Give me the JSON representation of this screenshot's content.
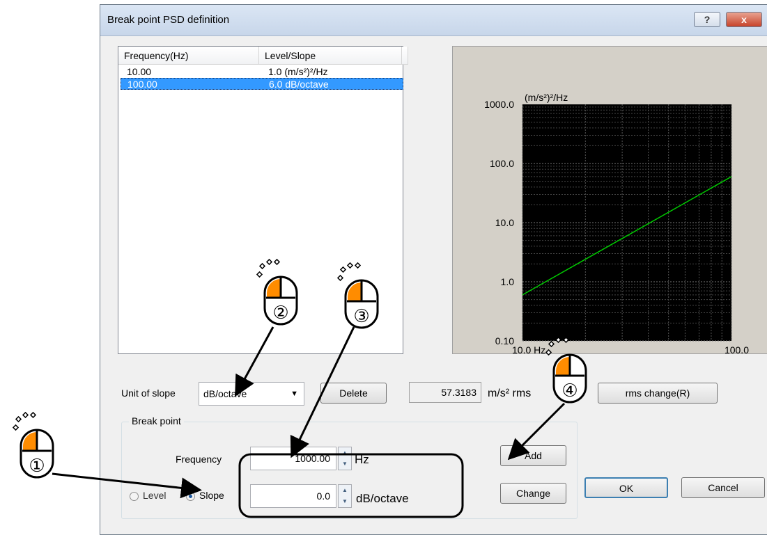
{
  "window": {
    "title": "Break point PSD definition",
    "help_label": "?",
    "close_label": "x"
  },
  "list": {
    "headers": [
      "Frequency(Hz)",
      "Level/Slope"
    ],
    "rows": [
      {
        "frequency": "10.00",
        "value": "1.0 (m/s²)²/Hz",
        "selected": false
      },
      {
        "frequency": "100.00",
        "value": "6.0  dB/octave",
        "selected": true
      }
    ]
  },
  "chart_data": {
    "type": "line",
    "y_unit": "(m/s²)²/Hz",
    "x_unit": "Hz",
    "xscale": "log",
    "yscale": "log",
    "xlim": [
      10.0,
      100.0
    ],
    "ylim": [
      0.1,
      1000.0
    ],
    "x_ticks": [
      "10.0",
      "100.0"
    ],
    "y_ticks": [
      "1000.0",
      "100.0",
      "10.0",
      "1.0",
      "0.10"
    ],
    "grid": true,
    "background": "#000000",
    "series": [
      {
        "x": [
          10.0,
          100.0
        ],
        "y": [
          0.6,
          60.0
        ],
        "color": "#00cc00"
      }
    ]
  },
  "controls": {
    "unit_of_slope_label": "Unit of slope",
    "unit_of_slope_value": "dB/octave",
    "delete_label": "Delete",
    "rms_value": "57.3183",
    "rms_unit": "m/s² rms",
    "rms_change_label": "rms change(R)",
    "breakpoint_legend": "Break point",
    "frequency_label": "Frequency",
    "frequency_value": "1000.00",
    "frequency_unit": "Hz",
    "level_label": "Level",
    "slope_label": "Slope",
    "slope_value": "0.0",
    "slope_unit": "dB/octave",
    "add_label": "Add",
    "change_label": "Change",
    "ok_label": "OK",
    "cancel_label": "Cancel",
    "selected_mode": "Slope"
  },
  "annotations": {
    "markers": [
      "①",
      "②",
      "③",
      "④"
    ],
    "mouse_color": "#ff8c00"
  }
}
